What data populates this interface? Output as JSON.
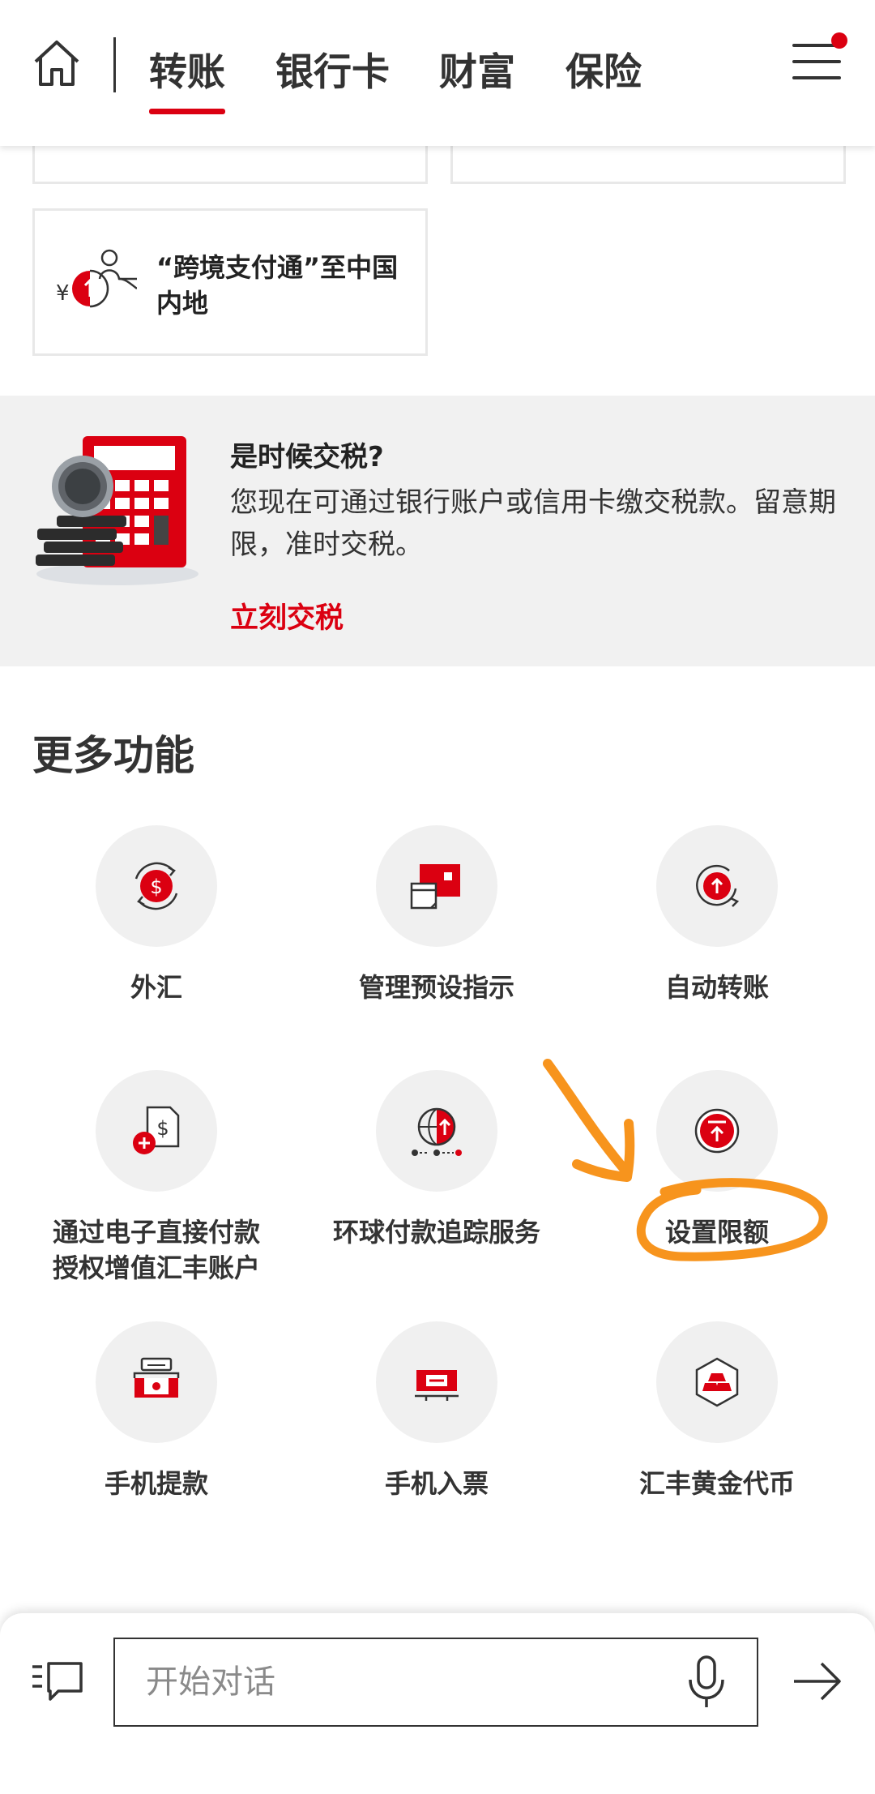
{
  "header": {
    "tabs": [
      {
        "label": "转账",
        "active": true
      },
      {
        "label": "银行卡",
        "active": false
      },
      {
        "label": "财富",
        "active": false
      },
      {
        "label": "保险",
        "active": false
      }
    ],
    "home_icon": "home-icon",
    "menu_icon": "hamburger-menu-icon",
    "notification_color": "#db0011"
  },
  "transfer_card": {
    "label": "“跨境支付通”至中国内地",
    "icon": "cross-border-payment-icon"
  },
  "tax_banner": {
    "title": "是时候交税?",
    "body": "您现在可通过银行账户或信用卡缴交税款。留意期限，准时交税。",
    "link": "立刻交税",
    "illustration": "calculator-coins-illustration"
  },
  "more_features": {
    "title": "更多功能",
    "items": [
      {
        "label": "外汇",
        "icon": "currency-exchange-icon"
      },
      {
        "label": "管理预设指示",
        "icon": "manage-instructions-icon"
      },
      {
        "label": "自动转账",
        "icon": "auto-transfer-icon"
      },
      {
        "label": "通过电子直接付款授权增值汇丰账户",
        "icon": "edda-topup-icon"
      },
      {
        "label": "环球付款追踪服务",
        "icon": "global-payment-tracker-icon"
      },
      {
        "label": "设置限额",
        "icon": "set-limit-icon"
      },
      {
        "label": "手机提款",
        "icon": "mobile-cash-withdrawal-icon"
      },
      {
        "label": "手机入票",
        "icon": "mobile-cheque-deposit-icon"
      },
      {
        "label": "汇丰黄金代币",
        "icon": "gold-token-icon"
      }
    ]
  },
  "chat": {
    "placeholder": "开始对话",
    "chat_icon": "chat-menu-icon",
    "mic_icon": "microphone-icon",
    "send_icon": "send-arrow-icon"
  },
  "colors": {
    "brand_red": "#db0011",
    "annotation_orange": "#f7941d"
  }
}
